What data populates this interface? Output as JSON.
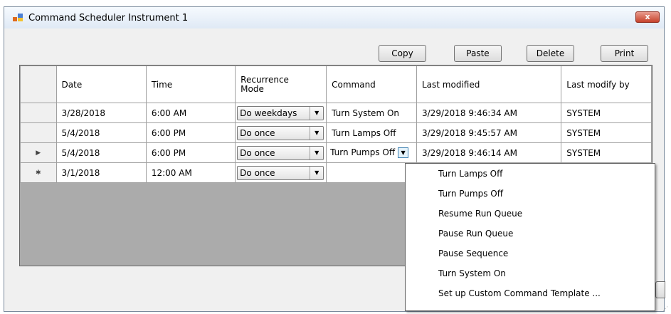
{
  "window": {
    "title": "Command Scheduler Instrument 1",
    "close_label": "x"
  },
  "toolbar": {
    "copy": "Copy",
    "paste": "Paste",
    "delete": "Delete",
    "print": "Print"
  },
  "grid": {
    "columns": [
      "Date",
      "Time",
      "Recurrence Mode",
      "Command",
      "Last modified",
      "Last modify by"
    ],
    "rows": [
      {
        "marker": "",
        "date": "3/28/2018",
        "time": "6:00 AM",
        "mode": "Do weekdays",
        "command": "Turn System On",
        "last_modified": "3/29/2018 9:46:34 AM",
        "last_modify_by": "SYSTEM"
      },
      {
        "marker": "",
        "date": "5/4/2018",
        "time": "6:00 PM",
        "mode": "Do once",
        "command": "Turn Lamps Off",
        "last_modified": "3/29/2018 9:45:57 AM",
        "last_modify_by": "SYSTEM"
      },
      {
        "marker": "▶",
        "date": "5/4/2018",
        "time": "6:00 PM",
        "mode": "Do once",
        "command": "Turn Pumps Off",
        "last_modified": "3/29/2018 9:46:14 AM",
        "last_modify_by": "SYSTEM"
      },
      {
        "marker": "✱",
        "date": "3/1/2018",
        "time": "12:00 AM",
        "mode": "Do once",
        "command": "",
        "last_modified": "",
        "last_modify_by": ""
      }
    ]
  },
  "command_dropdown": {
    "options": [
      "Turn Lamps Off",
      "Turn Pumps Off",
      "Resume Run Queue",
      "Pause Run Queue",
      "Pause Sequence",
      "Turn System On",
      "Set up Custom Command Template ..."
    ]
  },
  "colors": {
    "grid_background": "#ababab",
    "window_background": "#f0f0f0",
    "close_button": "#c7432c"
  }
}
